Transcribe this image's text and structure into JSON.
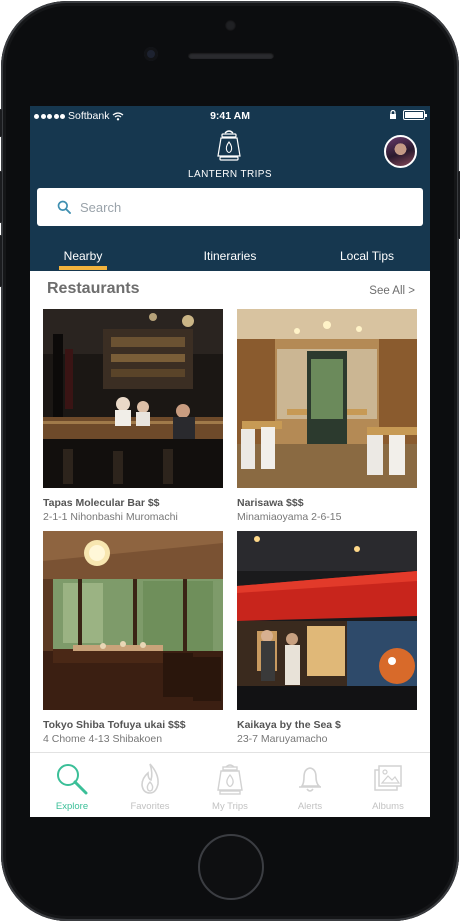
{
  "status_bar": {
    "carrier": "Softbank",
    "time": "9:41 AM"
  },
  "header": {
    "brand": "LANTERN TRIPS",
    "avatar": "user-avatar"
  },
  "search": {
    "placeholder": "Search"
  },
  "tabs": [
    {
      "label": "Nearby",
      "active": true
    },
    {
      "label": "Itineraries",
      "active": false
    },
    {
      "label": "Local Tips",
      "active": false
    }
  ],
  "section": {
    "title": "Restaurants",
    "see_all": "See All >"
  },
  "restaurants": [
    {
      "name": "Tapas Molecular Bar $$",
      "address": "2-1-1 Nihonbashi Muromachi"
    },
    {
      "name": "Narisawa $$$",
      "address": "Minamiaoyama 2-6-15"
    },
    {
      "name": "Tokyo Shiba Tofuya ukai $$$",
      "address": "4 Chome 4-13 Shibakoen"
    },
    {
      "name": "Kaikaya by the Sea $",
      "address": "23-7 Maruyamacho"
    }
  ],
  "tab_bar": [
    {
      "label": "Explore",
      "icon": "magnifier-icon",
      "active": true
    },
    {
      "label": "Favorites",
      "icon": "flame-icon",
      "active": false
    },
    {
      "label": "My Trips",
      "icon": "lantern-icon",
      "active": false
    },
    {
      "label": "Alerts",
      "icon": "bell-icon",
      "active": false
    },
    {
      "label": "Albums",
      "icon": "photo-album-icon",
      "active": false
    }
  ],
  "colors": {
    "header_bg": "#16374f",
    "accent_tab": "#f2b33d",
    "active_green": "#3bbf98"
  }
}
